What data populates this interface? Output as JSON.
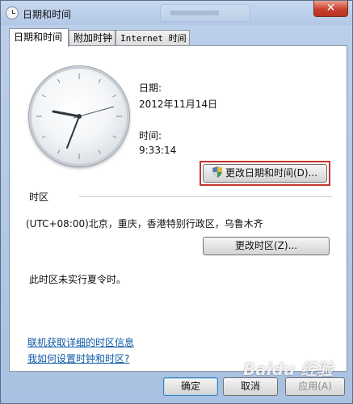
{
  "window": {
    "title": "日期和时间",
    "close_label": "✕"
  },
  "tabs": [
    {
      "label": "日期和时间"
    },
    {
      "label": "附加时钟"
    },
    {
      "label": "Internet 时间"
    }
  ],
  "clock": {
    "time": "9:33:14"
  },
  "date_section": {
    "date_label": "日期:",
    "date_value": "2012年11月14日",
    "time_label": "时间:",
    "time_value": "9:33:14",
    "change_button": "更改日期和时间(D)..."
  },
  "timezone_section": {
    "header": "时区",
    "value": "(UTC+08:00)北京，重庆，香港特别行政区，乌鲁木齐",
    "change_button": "更改时区(Z)...",
    "dst_note": "此时区未实行夏令时。"
  },
  "links": [
    "联机获取详细的时区信息",
    "我如何设置时钟和时区?"
  ],
  "footer": {
    "ok": "确定",
    "cancel": "取消",
    "apply": "应用(A)"
  },
  "watermark": "Baidu 经验",
  "colors": {
    "link": "#0d5aa7",
    "highlight": "#c3342a"
  }
}
